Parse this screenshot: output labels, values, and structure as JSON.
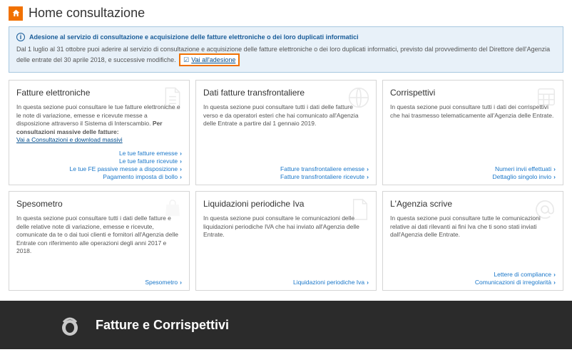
{
  "page": {
    "title": "Home consultazione"
  },
  "info": {
    "heading": "Adesione al servizio di consultazione e acquisizione delle fatture elettroniche o dei loro duplicati informatici",
    "body_pre": "Dal 1 luglio al 31 ottobre puoi aderire al servizio di consultazione e acquisizione delle fatture elettroniche o dei loro duplicati informatici, previsto dal provvedimento del Direttore dell'Agenzia delle entrate del 30 aprile 2018, e successive modifiche.",
    "link": "Vai all'adesione"
  },
  "cards": [
    {
      "title": "Fatture elettroniche",
      "desc": "In questa sezione puoi consultare le tue fatture elettroniche e le note di variazione, emesse e ricevute messe a disposizione attraverso il Sistema di Interscambio.",
      "desc_strong": "Per consultazioni massive delle fatture:",
      "sublink": "Vai a Consultazioni e download massivi",
      "links": [
        "Le tue fatture emesse",
        "Le tue fatture ricevute",
        "Le tue FE passive messe a disposizione",
        "Pagamento imposta di bollo"
      ]
    },
    {
      "title": "Dati fatture transfrontaliere",
      "desc": "In questa sezione puoi consultare tutti i dati delle fatture verso e da operatori esteri che hai comunicato all'Agenzia delle Entrate a partire dal 1 gennaio 2019.",
      "links": [
        "Fatture transfrontaliere emesse",
        "Fatture transfrontaliere ricevute"
      ]
    },
    {
      "title": "Corrispettivi",
      "desc": "In questa sezione puoi consultare tutti i dati dei corrispettivi che hai trasmesso telematicamente all'Agenzia delle Entrate.",
      "links": [
        "Numeri invii effettuati",
        "Dettaglio singolo invio"
      ]
    },
    {
      "title": "Spesometro",
      "desc": "In questa sezione puoi consultare tutti i dati delle fatture e delle relative note di variazione, emesse e ricevute, comunicate da te o dai tuoi clienti e fornitori all'Agenzia delle Entrate con riferimento alle operazioni degli anni 2017 e 2018.",
      "links": [
        "Spesometro"
      ]
    },
    {
      "title": "Liquidazioni periodiche Iva",
      "desc": "In questa sezione puoi consultare le comunicazioni delle liquidazioni periodiche IVA che hai inviato all'Agenzia delle Entrate.",
      "links": [
        "Liquidazioni periodiche Iva"
      ]
    },
    {
      "title": "L'Agenzia scrive",
      "desc": "In questa sezione puoi consultare tutte le comunicazioni relative ai dati rilevanti ai fini Iva che ti sono stati inviati dall'Agenzia delle Entrate.",
      "links": [
        "Lettere di compliance",
        "Comunicazioni di irregolarità"
      ]
    }
  ],
  "footer": {
    "title": "Fatture e Corrispettivi"
  }
}
